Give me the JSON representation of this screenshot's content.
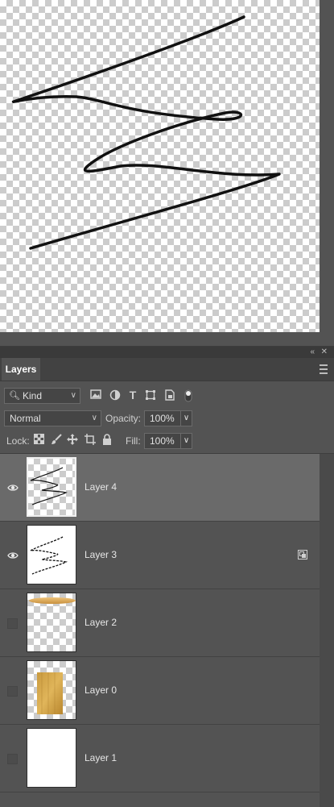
{
  "panel": {
    "collapse_icon": "double-chevron-left-icon",
    "close_icon": "close-icon",
    "tab_label": "Layers",
    "menu_icon": "hamburger-menu-icon"
  },
  "filter": {
    "kind_label": "Kind",
    "icons": [
      "image-filter-icon",
      "adjustment-filter-icon",
      "type-filter-icon",
      "shape-filter-icon",
      "smart-object-filter-icon",
      "filter-toggle-icon"
    ]
  },
  "blend": {
    "mode": "Normal",
    "opacity_label": "Opacity:",
    "opacity_value": "100%"
  },
  "lock": {
    "label": "Lock:",
    "icons": [
      "lock-transparent-icon",
      "lock-image-icon",
      "lock-position-icon",
      "lock-artboard-icon",
      "lock-all-icon"
    ],
    "fill_label": "Fill:",
    "fill_value": "100%"
  },
  "layers": [
    {
      "name": "Layer 4",
      "visible": true,
      "selected": true,
      "thumb": "scribble-transparent"
    },
    {
      "name": "Layer 3",
      "visible": true,
      "selected": false,
      "thumb": "scribble-white",
      "smart_object": true
    },
    {
      "name": "Layer 2",
      "visible": false,
      "selected": false,
      "thumb": "wood-strip"
    },
    {
      "name": "Layer 0",
      "visible": false,
      "selected": false,
      "thumb": "wood-block"
    },
    {
      "name": "Layer 1",
      "visible": false,
      "selected": false,
      "thumb": "white"
    }
  ],
  "colors": {
    "panel_bg": "#535353",
    "selected_row": "#6a6a6a",
    "tab_bar": "#424242"
  }
}
